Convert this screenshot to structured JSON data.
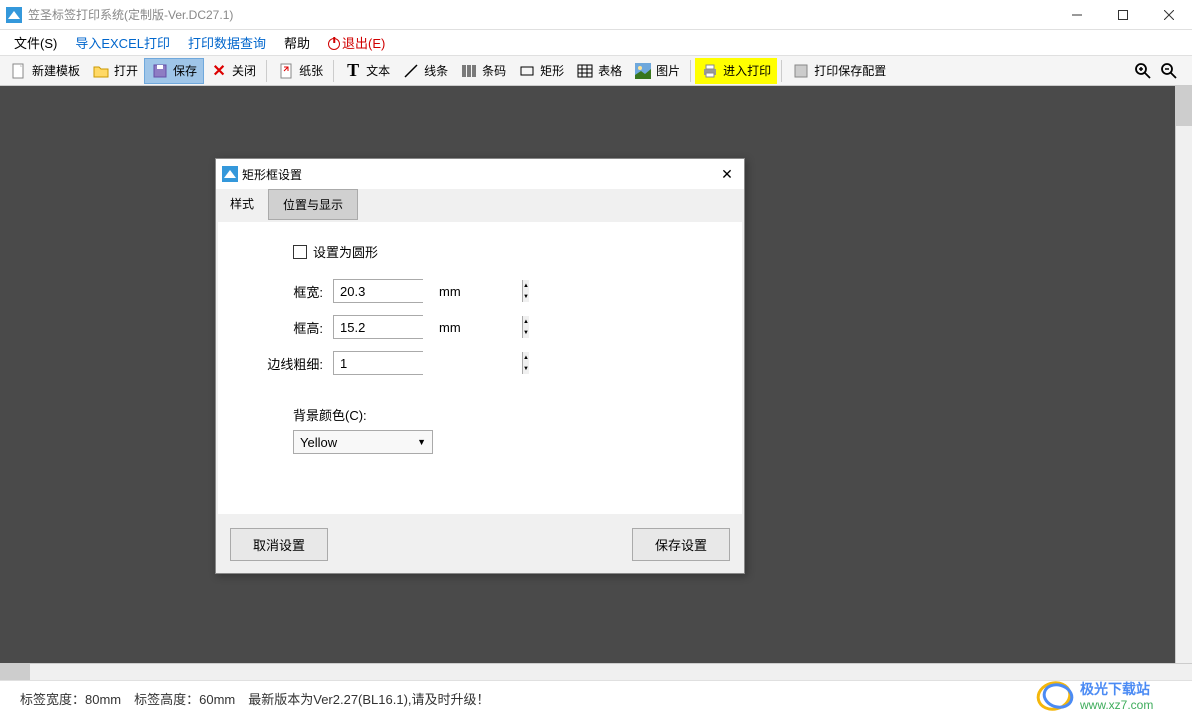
{
  "window": {
    "title": "笠圣标签打印系统(定制版-Ver.DC27.1)"
  },
  "menu": {
    "file": "文件(S)",
    "excel": "导入EXCEL打印",
    "query": "打印数据查询",
    "help": "帮助",
    "exit": "退出(E)"
  },
  "toolbar": {
    "new_template": "新建模板",
    "open": "打开",
    "save": "保存",
    "close": "关闭",
    "paper": "纸张",
    "text": "文本",
    "line": "线条",
    "barcode": "条码",
    "rect": "矩形",
    "table": "表格",
    "image": "图片",
    "print": "进入打印",
    "save_config": "打印保存配置"
  },
  "dialog": {
    "title": "矩形框设置",
    "tab_style": "样式",
    "tab_position": "位置与显示",
    "set_circle": "设置为圆形",
    "width_label": "框宽:",
    "width_value": "20.3",
    "height_label": "框高:",
    "height_value": "15.2",
    "border_label": "边线粗细:",
    "border_value": "1",
    "unit": "mm",
    "bg_label": "背景颜色(C):",
    "bg_value": "Yellow",
    "cancel": "取消设置",
    "save": "保存设置"
  },
  "status": {
    "text": "标签宽度：80mm　标签高度：60mm　最新版本为Ver2.27(BL16.1),请及时升级！"
  },
  "watermark": {
    "line1": "极光下载站",
    "url": "www.xz7.com"
  }
}
